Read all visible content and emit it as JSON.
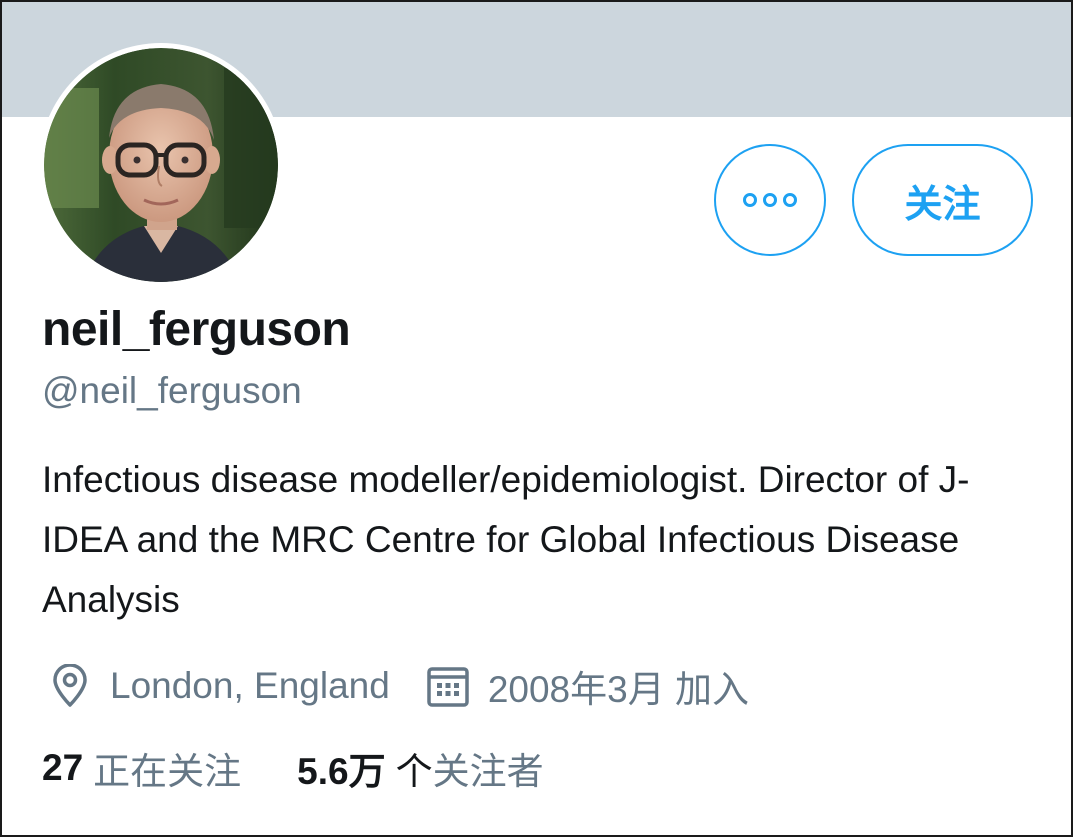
{
  "profile": {
    "display_name": "neil_ferguson",
    "handle": "@neil_ferguson",
    "bio": "Infectious disease modeller/epidemiologist. Director of J-IDEA and the MRC Centre for Global Infectious Disease Analysis",
    "location": "London, England",
    "joined": "2008年3月 加入",
    "avatar_icon": "profile-photo"
  },
  "actions": {
    "more_icon": "more-dots-icon",
    "follow_label": "关注"
  },
  "stats": {
    "following_count": "27",
    "following_label": "正在关注",
    "followers_count": "5.6万",
    "followers_unit": "个",
    "followers_label": "关注者"
  },
  "colors": {
    "accent": "#1da1f2",
    "banner": "#ccd6dd",
    "secondary_text": "#657786",
    "primary_text": "#14171a"
  }
}
